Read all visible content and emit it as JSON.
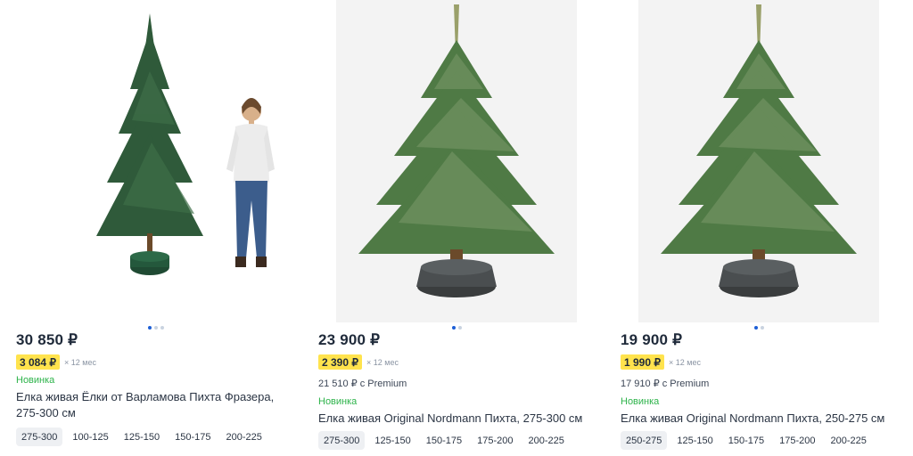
{
  "products": [
    {
      "price": "30 850 ₽",
      "installment": "3 084 ₽",
      "installment_term": "× 12 мес",
      "premium": "",
      "badge": "Новинка",
      "title": "Елка живая Ёлки от Варламова Пихта Фразера, 275-300 см",
      "sizes": [
        "275-300",
        "100-125",
        "125-150",
        "150-175",
        "200-225"
      ],
      "selected_size_index": 0,
      "carousel_active_index": 0,
      "carousel_count": 3
    },
    {
      "price": "23 900 ₽",
      "installment": "2 390 ₽",
      "installment_term": "× 12 мес",
      "premium": "21 510 ₽ с Premium",
      "badge": "Новинка",
      "title": "Елка живая Original Nordmann Пихта, 275-300 см",
      "sizes": [
        "275-300",
        "125-150",
        "150-175",
        "175-200",
        "200-225"
      ],
      "selected_size_index": 0,
      "carousel_active_index": 0,
      "carousel_count": 2
    },
    {
      "price": "19 900 ₽",
      "installment": "1 990 ₽",
      "installment_term": "× 12 мес",
      "premium": "17 910 ₽ с Premium",
      "badge": "Новинка",
      "title": "Елка живая Original Nordmann Пихта, 250-275 см",
      "sizes": [
        "250-275",
        "125-150",
        "150-175",
        "175-200",
        "200-225"
      ],
      "selected_size_index": 0,
      "carousel_active_index": 0,
      "carousel_count": 2
    }
  ],
  "colors": {
    "accent": "#1d5fd6",
    "new_badge": "#2db34a",
    "installment_highlight": "#ffe34d",
    "text_primary": "#1f2a3a",
    "text_muted": "#8a94a3"
  }
}
